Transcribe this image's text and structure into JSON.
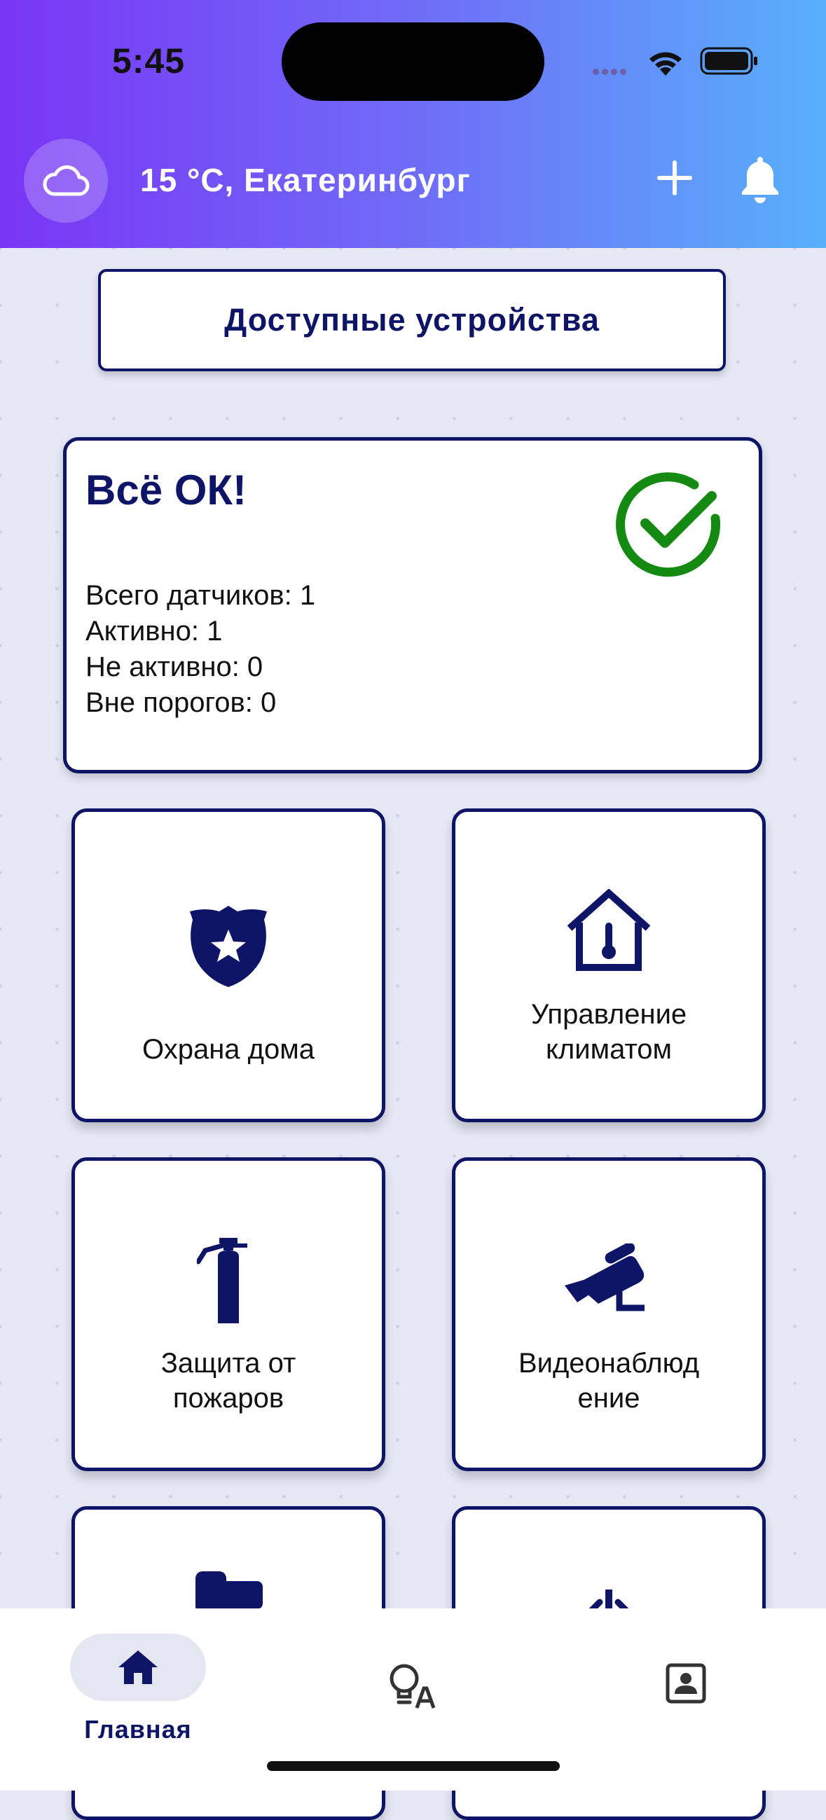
{
  "status_bar": {
    "time": "5:45"
  },
  "header": {
    "weather_text": "15 °C, Екатеринбург",
    "icons": [
      "cloud-icon",
      "plus-icon",
      "bell-icon"
    ]
  },
  "devices_button": {
    "label": "Доступные устройства"
  },
  "status_card": {
    "title": "Всё ОК!",
    "lines": [
      "Всего датчиков: 1",
      "Активно: 1",
      "Не активно: 0",
      "Вне порогов: 0"
    ],
    "icon": "check-circle-icon"
  },
  "tiles": [
    {
      "label_line1": "Охрана дома",
      "label_line2": "",
      "icon": "shield-star-icon"
    },
    {
      "label_line1": "Управление",
      "label_line2": "климатом",
      "icon": "house-thermometer-icon"
    },
    {
      "label_line1": "Защита от",
      "label_line2": "пожаров",
      "icon": "fire-extinguisher-icon"
    },
    {
      "label_line1": "Видеонаблюд",
      "label_line2": "ение",
      "icon": "security-camera-icon"
    }
  ],
  "tab_bar": {
    "home_label": "Главная",
    "icons": [
      "home-icon",
      "lightbulb-icon",
      "profile-icon"
    ]
  },
  "colors": {
    "primary": "#0f1566",
    "success": "#148a12",
    "header_gradient_start": "#7a35f5",
    "header_gradient_end": "#58b0fb",
    "background": "#e6e8f5"
  }
}
